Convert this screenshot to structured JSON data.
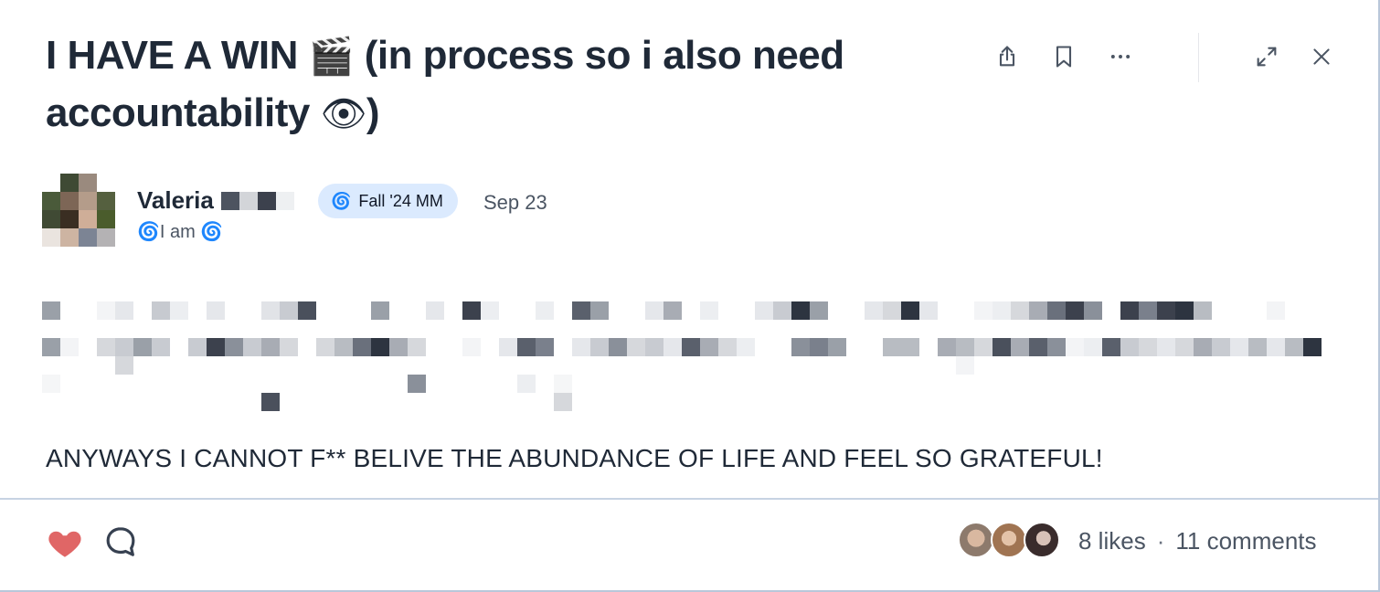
{
  "post": {
    "title": "I HAVE A WIN",
    "title_emoji_1": "🎬",
    "title_mid": "(in process so i also need accountability",
    "title_emoji_2": "👁",
    "title_end": ")",
    "author_name": "Valeria",
    "author_bio_prefix": "🌀",
    "author_bio_text": "I am",
    "author_bio_suffix": "🌀",
    "badge_icon": "🌀",
    "badge_label": "Fall '24 MM",
    "date": "Sep 23",
    "body_text": "ANYWAYS I CANNOT F** BELIVE THE ABUNDANCE OF LIFE AND FEEL SO GRATEFUL!"
  },
  "toolbar": {
    "icons": [
      "share-icon",
      "bookmark-icon",
      "more-icon",
      "expand-icon",
      "close-icon"
    ]
  },
  "footer": {
    "likes": "8 likes",
    "separator": "·",
    "comments": "11 comments",
    "like_icon": "heart-icon",
    "comment_icon": "comment-icon"
  },
  "colors": {
    "heart": "#e06666",
    "badge_bg": "#dbeafe",
    "text": "#1f2937",
    "muted": "#4b5563"
  }
}
